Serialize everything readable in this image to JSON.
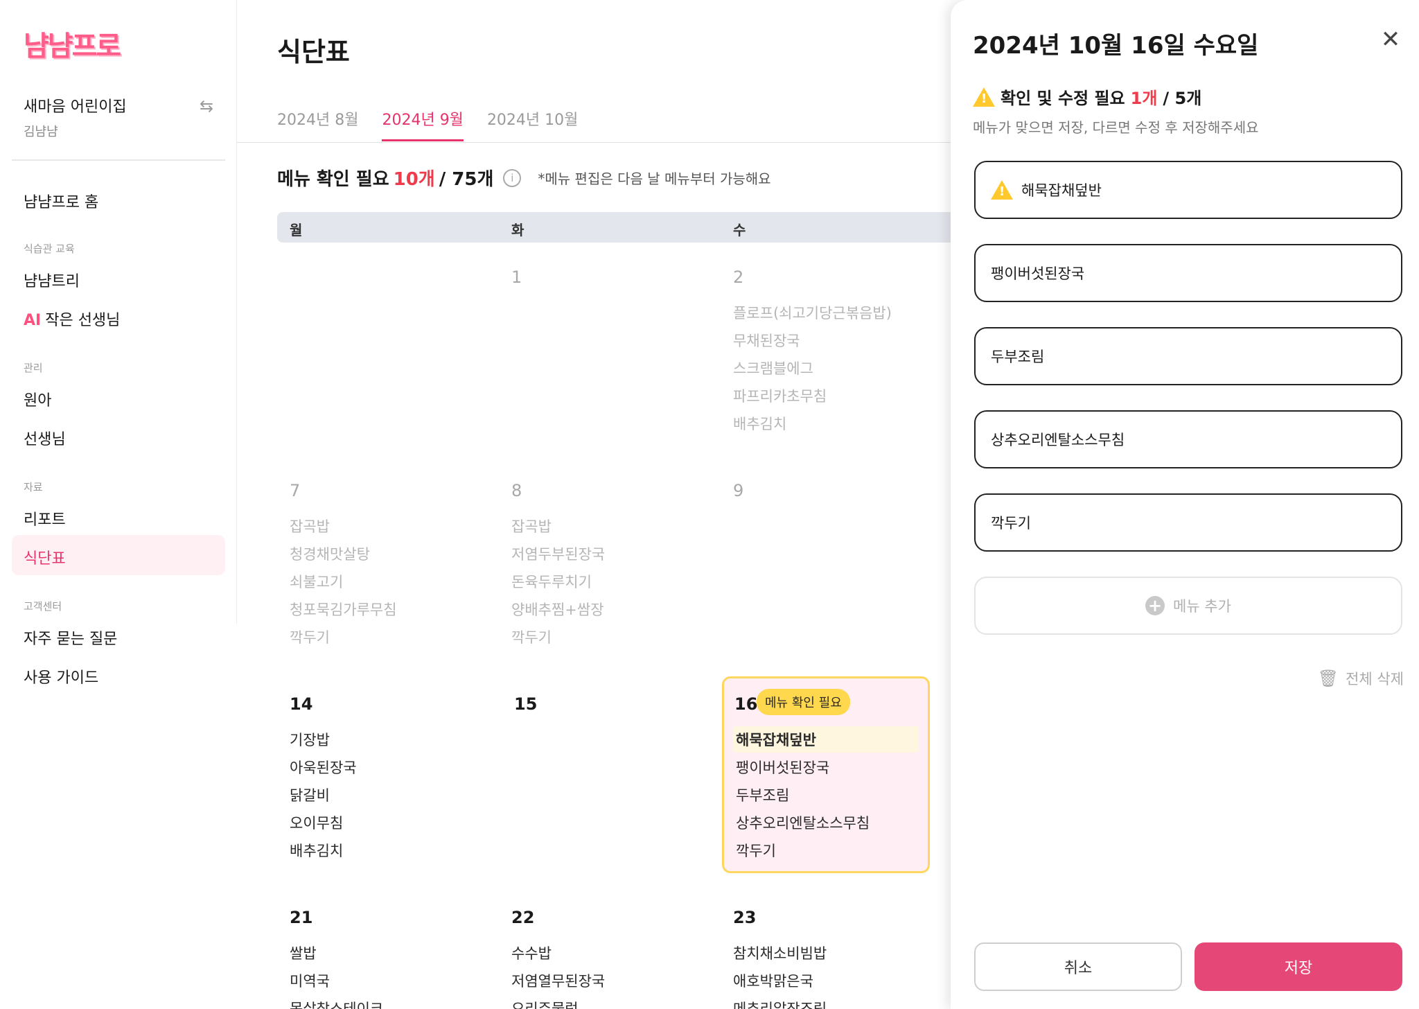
{
  "app": {
    "logo": "냠냠프로"
  },
  "org": {
    "name": "새마음 어린이집",
    "user": "김냠냠"
  },
  "sidebar": {
    "home": "냠냠프로 홈",
    "section_education": "식습관 교육",
    "tree": "냠냠트리",
    "ai_tag": "AI",
    "ai_teacher": "작은 선생님",
    "section_manage": "관리",
    "children": "원아",
    "teachers": "선생님",
    "section_data": "자료",
    "report": "리포트",
    "menu_table": "식단표",
    "section_support": "고객센터",
    "faq": "자주 묻는 질문",
    "guide": "사용 가이드"
  },
  "main": {
    "title": "식단표",
    "tabs": [
      "2024년 8월",
      "2024년 9월",
      "2024년 10월"
    ],
    "summary_label": "메뉴 확인 필요",
    "summary_count": "10개",
    "summary_total": "/ 75개",
    "summary_note": "*메뉴 편집은 다음 날 메뉴부터 가능해요",
    "weekdays": [
      "월",
      "화",
      "수"
    ],
    "badge": "메뉴 확인 필요",
    "weeks": [
      {
        "mon": {
          "date": "",
          "menu": []
        },
        "tue": {
          "date": "1",
          "menu": []
        },
        "wed": {
          "date": "2",
          "menu": [
            "플로프(쇠고기당근볶음밥)",
            "무채된장국",
            "스크램블에그",
            "파프리카초무침",
            "배추김치"
          ]
        }
      },
      {
        "mon": {
          "date": "7",
          "menu": [
            "잡곡밥",
            "청경채맛살탕",
            "쇠불고기",
            "청포묵김가루무침",
            "깍두기"
          ]
        },
        "tue": {
          "date": "8",
          "menu": [
            "잡곡밥",
            "저염두부된장국",
            "돈육두루치기",
            "양배추찜+쌈장",
            "깍두기"
          ]
        },
        "wed": {
          "date": "9",
          "menu": []
        }
      },
      {
        "mon": {
          "date": "14",
          "menu": [
            "기장밥",
            "아욱된장국",
            "닭갈비",
            "오이무침",
            "배추김치"
          ]
        },
        "tue": {
          "date": "15",
          "menu": []
        },
        "wed": {
          "date": "16",
          "menu": [
            "해묵잡채덮반",
            "팽이버섯된장국",
            "두부조림",
            "상추오리엔탈소스무침",
            "깍두기"
          ]
        }
      },
      {
        "mon": {
          "date": "21",
          "menu": [
            "쌀밥",
            "미역국",
            "목살찹스테이크"
          ]
        },
        "tue": {
          "date": "22",
          "menu": [
            "수수밥",
            "저염열무된장국",
            "오리주물럭"
          ]
        },
        "wed": {
          "date": "23",
          "menu": [
            "참치채소비빔밥",
            "애호박맑은국",
            "메추리알장조림"
          ]
        }
      }
    ]
  },
  "panel": {
    "title": "2024년 10월 16일 수요일",
    "warn_label": "확인 및 수정 필요",
    "warn_count": "1개",
    "warn_total": "/ 5개",
    "warn_sub": "메뉴가 맞으면 저장, 다르면 수정 후 저장해주세요",
    "items": [
      "해묵잡채덮반",
      "팽이버섯된장국",
      "두부조림",
      "상추오리엔탈소스무침",
      "깍두기"
    ],
    "add_label": "메뉴 추가",
    "delete_all": "전체 삭제",
    "cancel": "취소",
    "save": "저장"
  },
  "colors": {
    "accent": "#e54877",
    "warning": "#ffc82c",
    "count_red": "#ef3b4c"
  }
}
